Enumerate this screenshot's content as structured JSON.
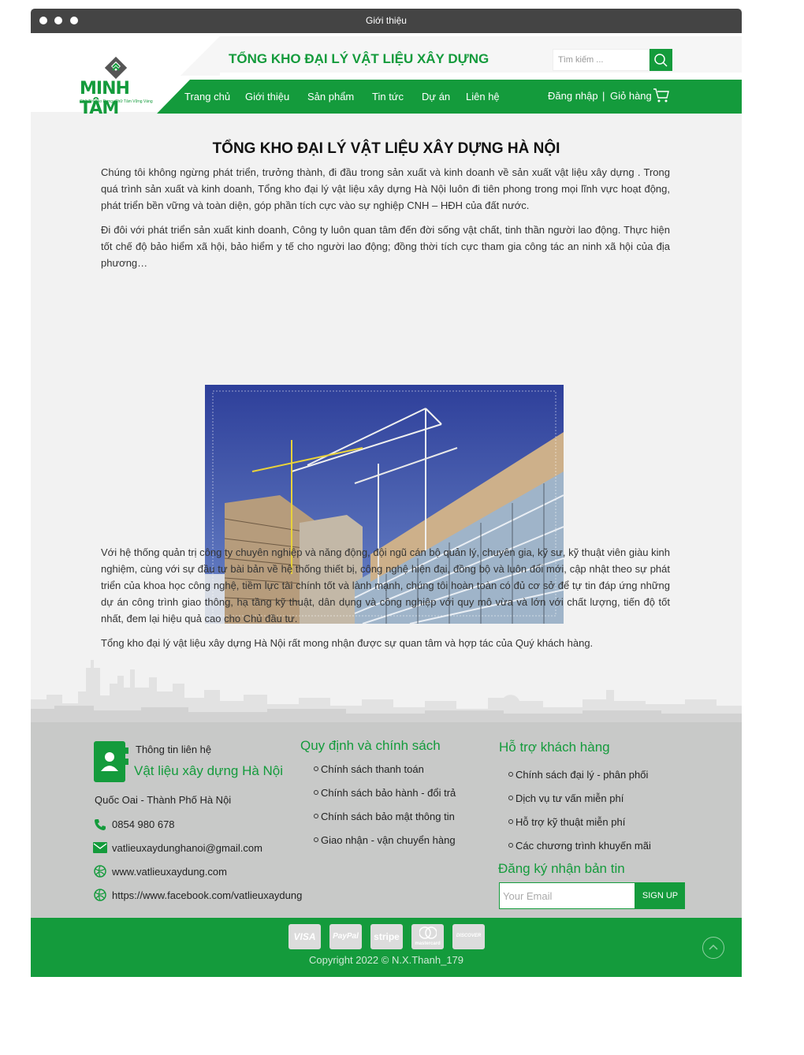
{
  "window": {
    "title": "Giới thiệu"
  },
  "header": {
    "logo_text": "MINH TÂM",
    "logo_slogan": "Chữ Tín Tạo Dựng, Chữ Tâm Vững Vàng",
    "brand_title": "TỔNG KHO ĐẠI LÝ VẬT LIỆU XÂY DỰNG",
    "search_placeholder": "Tìm kiếm ...",
    "nav": [
      "Trang chủ",
      "Giới thiệu",
      "Sản phẩm",
      "Tin tức",
      "Dự án",
      "Liên hệ"
    ],
    "login": "Đăng nhập",
    "separator": "|",
    "cart": "Giỏ hàng"
  },
  "content": {
    "title": "TỔNG KHO ĐẠI LÝ VẬT LIỆU XÂY DỰNG HÀ NỘI",
    "p1": "Chúng tôi không ngừng phát triển, trưởng thành, đi đầu trong sản xuất và kinh doanh về sản xuất vật liệu xây dựng . Trong quá trình sản xuất và kinh doanh, Tổng kho đại lý vật liệu xây dựng Hà Nội luôn đi tiên phong trong mọi lĩnh vực hoạt động, phát triển bền vững và toàn diện, góp phần tích cực vào sự nghiệp CNH – HĐH của đất nước.",
    "p2": "Đi đôi với phát triển sản xuất kinh doanh, Công ty luôn quan tâm đến đời sống vật chất, tinh thần người lao động. Thực hiện tốt chế độ bảo hiểm xã hội, bảo hiểm y tế cho người lao động; đồng thời tích cực tham gia công tác an ninh xã hội của địa phương…",
    "p3": "Với hệ thống quản trị công ty chuyên nghiệp và năng động, đội ngũ cán bộ quản lý, chuyên gia, kỹ sư, kỹ thuật viên giàu kinh nghiệm, cùng với sự đầu tư bài bản về hệ thống thiết bị, công nghệ hiện đại, đồng bộ và luôn đổi mới, cập nhật theo sự phát triển của khoa học công nghệ, tiềm lực tài chính tốt và lành mạnh, chúng tôi hoàn toàn có đủ cơ sở để tự tin đáp ứng những dự án công trình giao thông, hạ tầng kỹ thuật, dân dụng và công nghiệp với quy mô vừa và lớn với chất lượng, tiến độ tốt nhất, đem lại hiệu quả cao cho Chủ đầu tư.",
    "p4": "Tổng kho đại lý vật liệu xây dựng Hà Nội rất mong nhận được sự quan tâm và hợp tác của Quý khách hàng."
  },
  "footer": {
    "contact": {
      "label": "Thông tin liên hệ",
      "name": "Vật liệu xây dựng Hà Nội",
      "address": "Quốc Oai - Thành Phố Hà Nội",
      "phone": "0854 980 678",
      "email": "vatlieuxaydunghanoi@gmail.com",
      "website": "www.vatlieuxaydung.com",
      "facebook": "https://www.facebook.com/vatlieuxaydung"
    },
    "policy": {
      "heading": "Quy định và chính sách",
      "items": [
        "Chính sách thanh toán",
        "Chính sách bảo hành - đổi trả",
        "Chính sách bảo mật thông tin",
        "Giao nhận - vận chuyển hàng"
      ]
    },
    "support": {
      "heading": "Hỗ trợ khách hàng",
      "items": [
        "Chính sách đại lý - phân phối",
        "Dịch vụ tư vấn miễn phí",
        "Hỗ trợ kỹ thuật miễn phí",
        "Các chương trình khuyến mãi"
      ]
    },
    "newsletter": {
      "heading": "Đăng ký nhận bản tin",
      "placeholder": "Your Email",
      "button": "SIGN UP"
    },
    "payments": [
      "VISA",
      "PayPal",
      "stripe",
      "mastercard",
      "DISCOVER"
    ],
    "copyright": "Copyright 2022 © N.X.Thanh_179"
  },
  "colors": {
    "brand_green": "#149b3c",
    "titlebar": "#444444",
    "footer_bg": "#c8c9c8"
  }
}
